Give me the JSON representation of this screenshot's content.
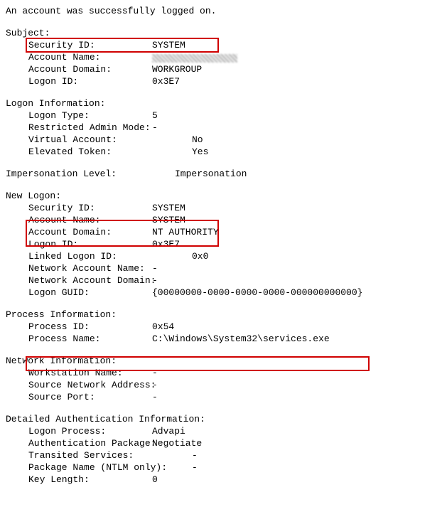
{
  "title": "An account was successfully logged on.",
  "subject": {
    "heading": "Subject:",
    "security_id": {
      "label": "Security ID:",
      "value": "SYSTEM"
    },
    "account_name": {
      "label": "Account Name:",
      "value": ""
    },
    "account_domain": {
      "label": "Account Domain:",
      "value": "WORKGROUP"
    },
    "logon_id": {
      "label": "Logon ID:",
      "value": "0x3E7"
    }
  },
  "logon_info": {
    "heading": "Logon Information:",
    "logon_type": {
      "label": "Logon Type:",
      "value": "5"
    },
    "restricted_admin": {
      "label": "Restricted Admin Mode:",
      "value": "-"
    },
    "virtual_account": {
      "label": "Virtual Account:",
      "value": "No"
    },
    "elevated_token": {
      "label": "Elevated Token:",
      "value": "Yes"
    }
  },
  "impersonation": {
    "label": "Impersonation Level:",
    "value": "Impersonation"
  },
  "new_logon": {
    "heading": "New Logon:",
    "security_id": {
      "label": "Security ID:",
      "value": "SYSTEM"
    },
    "account_name": {
      "label": "Account Name:",
      "value": "SYSTEM"
    },
    "account_domain": {
      "label": "Account Domain:",
      "value": "NT AUTHORITY"
    },
    "logon_id": {
      "label": "Logon ID:",
      "value": "0x3E7"
    },
    "linked_logon_id": {
      "label": "Linked Logon ID:",
      "value": "0x0"
    },
    "network_account_name": {
      "label": "Network Account Name:",
      "value": "-"
    },
    "network_account_domain": {
      "label": "Network Account Domain:",
      "value": "-"
    },
    "logon_guid": {
      "label": "Logon GUID:",
      "value": "{00000000-0000-0000-0000-000000000000}"
    }
  },
  "process_info": {
    "heading": "Process Information:",
    "process_id": {
      "label": "Process ID:",
      "value": "0x54"
    },
    "process_name": {
      "label": "Process Name:",
      "value": "C:\\Windows\\System32\\services.exe"
    }
  },
  "network_info": {
    "heading": "Network Information:",
    "workstation_name": {
      "label": "Workstation Name:",
      "value": "-"
    },
    "source_network_address": {
      "label": "Source Network Address:",
      "value": "-"
    },
    "source_port": {
      "label": "Source Port:",
      "value": "-"
    }
  },
  "auth_info": {
    "heading": "Detailed Authentication Information:",
    "logon_process": {
      "label": "Logon Process:",
      "value": "Advapi"
    },
    "auth_package": {
      "label": "Authentication Package:",
      "value": "Negotiate"
    },
    "transited_services": {
      "label": "Transited Services:",
      "value": "-"
    },
    "package_name": {
      "label": "Package Name (NTLM only):",
      "value": "-"
    },
    "key_length": {
      "label": "Key Length:",
      "value": "0"
    }
  }
}
